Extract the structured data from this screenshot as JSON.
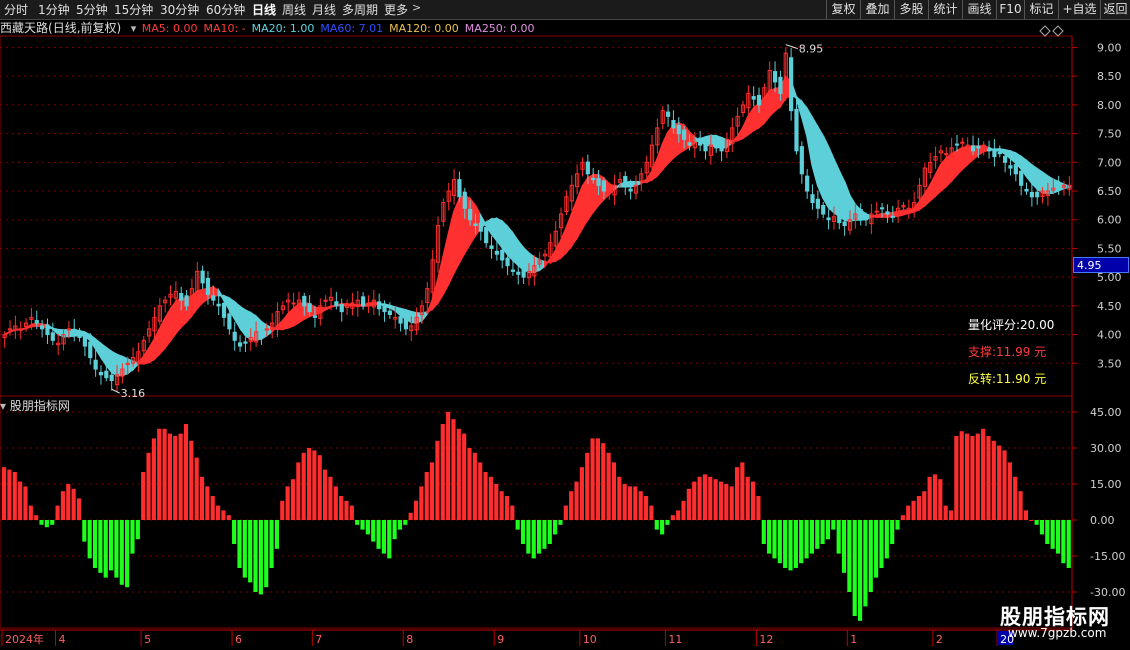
{
  "toolbar": {
    "tabs": [
      "分时",
      "1分钟",
      "5分钟",
      "15分钟",
      "30分钟",
      "60分钟",
      "日线",
      "周线",
      "月线",
      "多周期",
      "更多"
    ],
    "active_tab": "日线",
    "right_buttons": [
      "复权",
      "叠加",
      "多股",
      "统计",
      "画线",
      "F10",
      "标记",
      "+自选",
      "返回"
    ]
  },
  "stock": {
    "name": "西藏天路",
    "mode": "(日线,前复权)"
  },
  "ma_legend": [
    {
      "label": "MA5: 0.00",
      "color": "#ff3b3b"
    },
    {
      "label": "MA10: -",
      "color": "#ff3b3b"
    },
    {
      "label": "MA20: 1.00",
      "color": "#5fd3e0"
    },
    {
      "label": "MA60: 7.01",
      "color": "#2f4fff"
    },
    {
      "label": "MA120: 0.00",
      "color": "#e8c04b"
    },
    {
      "label": "MA250: 0.00",
      "color": "#e090e0"
    }
  ],
  "indicator_title": "股朋指标网",
  "info": {
    "score": "量化评分:20.00",
    "support": "支撑:11.99 元",
    "reversal": "反转:11.90 元"
  },
  "current_price": "4.95",
  "annotations": {
    "high": "8.95",
    "low": "3.16"
  },
  "watermark": {
    "title": "股朋指标网",
    "url": "www.7gpzb.com"
  },
  "colors": {
    "up": "#ff2d2d",
    "down": "#1eff1e",
    "ribbon_up": "#ff3030",
    "ribbon_down": "#5ccfd8",
    "grid": "#7a0000"
  },
  "chart_data": [
    {
      "type": "candlestick",
      "title": "",
      "y_ticks": [
        3.5,
        4.0,
        4.5,
        5.0,
        5.5,
        6.0,
        6.5,
        7.0,
        7.5,
        8.0,
        8.5,
        9.0
      ],
      "y_tick_labels": [
        "3.50",
        "4.00",
        "4.50",
        "5.00",
        "5.50",
        "6.00",
        "6.50",
        "7.00",
        "7.50",
        "8.00",
        "8.50",
        "9.00"
      ],
      "ylim": [
        3.0,
        9.2
      ],
      "x_labels": [
        "2024年",
        "4",
        "5",
        "6",
        "7",
        "8",
        "9",
        "10",
        "11",
        "12",
        "1",
        "2",
        "20"
      ],
      "x_label_days": [
        0,
        10,
        26,
        43,
        58,
        75,
        92,
        108,
        124,
        141,
        158,
        174,
        186
      ],
      "n_days": 200,
      "close": [
        4.0,
        4.1,
        4.15,
        4.1,
        4.2,
        4.3,
        4.2,
        4.1,
        4.0,
        3.9,
        3.85,
        4.0,
        4.1,
        4.05,
        3.95,
        3.8,
        3.6,
        3.4,
        3.3,
        3.25,
        3.2,
        3.3,
        3.4,
        3.5,
        3.6,
        3.7,
        3.9,
        4.1,
        4.3,
        4.5,
        4.6,
        4.7,
        4.75,
        4.6,
        4.5,
        4.8,
        5.1,
        4.9,
        4.7,
        4.6,
        4.5,
        4.3,
        4.1,
        3.9,
        3.8,
        3.85,
        3.95,
        4.05,
        4.0,
        4.1,
        4.2,
        4.4,
        4.5,
        4.6,
        4.55,
        4.6,
        4.5,
        4.4,
        4.3,
        4.5,
        4.6,
        4.65,
        4.5,
        4.4,
        4.5,
        4.55,
        4.6,
        4.5,
        4.55,
        4.6,
        4.45,
        4.4,
        4.35,
        4.3,
        4.2,
        4.1,
        4.15,
        4.3,
        4.5,
        4.8,
        5.3,
        5.9,
        6.3,
        6.5,
        6.7,
        6.4,
        6.2,
        6.0,
        5.9,
        5.8,
        5.6,
        5.5,
        5.4,
        5.3,
        5.2,
        5.1,
        5.05,
        5.0,
        5.1,
        5.2,
        5.3,
        5.4,
        5.6,
        5.8,
        6.1,
        6.4,
        6.6,
        6.8,
        7.0,
        6.8,
        6.7,
        6.6,
        6.5,
        6.5,
        6.6,
        6.7,
        6.6,
        6.5,
        6.6,
        6.8,
        7.0,
        7.3,
        7.6,
        7.9,
        7.8,
        7.6,
        7.5,
        7.4,
        7.3,
        7.35,
        7.3,
        7.2,
        7.3,
        7.25,
        7.2,
        7.4,
        7.6,
        7.8,
        8.0,
        8.2,
        8.1,
        8.0,
        8.3,
        8.6,
        8.4,
        8.2,
        8.9,
        7.9,
        7.2,
        6.8,
        6.5,
        6.3,
        6.2,
        6.1,
        6.0,
        6.05,
        5.95,
        5.9,
        6.0,
        6.1,
        6.05,
        6.0,
        6.1,
        6.15,
        6.2,
        6.1,
        6.05,
        6.2,
        6.25,
        6.2,
        6.3,
        6.6,
        6.9,
        7.0,
        7.1,
        7.2,
        7.15,
        7.25,
        7.3,
        7.35,
        7.3,
        7.2,
        7.25,
        7.3,
        7.2,
        7.1,
        7.15,
        7.0,
        6.9,
        6.8,
        6.6,
        6.5,
        6.4,
        6.4,
        6.5,
        6.5,
        6.55,
        6.6,
        6.6,
        6.6
      ]
    },
    {
      "type": "bar",
      "title": "",
      "y_ticks": [
        -30,
        -15,
        0,
        15,
        30,
        45
      ],
      "y_tick_labels": [
        "-30.00",
        "-15.00",
        "0.00",
        "15.00",
        "30.00",
        "45.00"
      ],
      "ylim": [
        -45,
        50
      ],
      "values": [
        22,
        21,
        20,
        16,
        14,
        6,
        2,
        -2,
        -3,
        -2,
        6,
        12,
        15,
        13,
        9,
        -9,
        -16,
        -20,
        -22,
        -24,
        -21,
        -24,
        -27,
        -28,
        -14,
        -8,
        20,
        28,
        34,
        38,
        38,
        36,
        35,
        36,
        40,
        33,
        26,
        18,
        14,
        10,
        6,
        4,
        2,
        -10,
        -20,
        -24,
        -26,
        -30,
        -31,
        -28,
        -20,
        -12,
        8,
        14,
        17,
        24,
        28,
        30,
        29,
        27,
        21,
        18,
        14,
        10,
        8,
        6,
        -2,
        -4,
        -6,
        -9,
        -12,
        -14,
        -16,
        -8,
        -4,
        -2,
        3,
        8,
        14,
        20,
        24,
        33,
        40,
        45,
        42,
        38,
        36,
        30,
        28,
        24,
        20,
        18,
        15,
        12,
        10,
        6,
        -4,
        -10,
        -14,
        -16,
        -14,
        -12,
        -10,
        -6,
        -2,
        6,
        12,
        16,
        22,
        28,
        34,
        34,
        32,
        28,
        24,
        18,
        15,
        14,
        14,
        12,
        10,
        6,
        -4,
        -6,
        -2,
        2,
        4,
        8,
        13,
        16,
        18,
        19,
        18,
        17,
        16,
        15,
        14,
        22,
        24,
        18,
        16,
        10,
        -10,
        -14,
        -16,
        -18,
        -20,
        -21,
        -20,
        -18,
        -16,
        -14,
        -12,
        -10,
        -8,
        -4,
        -14,
        -22,
        -30,
        -40,
        -42,
        -36,
        -30,
        -24,
        -20,
        -16,
        -10,
        -4,
        2,
        6,
        8,
        10,
        12,
        18,
        19,
        17,
        6,
        4,
        35,
        37,
        36,
        35,
        36,
        38,
        35,
        33,
        31,
        29,
        24,
        18,
        12,
        4,
        0,
        -2,
        -6,
        -10,
        -12,
        -14,
        -18,
        -20
      ]
    }
  ]
}
